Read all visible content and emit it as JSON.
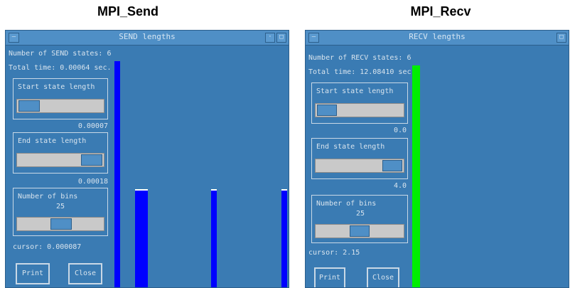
{
  "captions": {
    "left": "MPI_Send",
    "right": "MPI_Recv"
  },
  "windows": [
    {
      "title": "SEND lengths",
      "states_label": "Number of SEND states:  6",
      "total_time_label": "Total time:  0.00064 sec.",
      "start_group_label": "Start state length",
      "start_value": "0.00007",
      "end_group_label": "End state length",
      "end_value": "0.00018",
      "bins_group_label": "Number of bins",
      "bins_value": "25",
      "cursor_label": "cursor: 0.000087",
      "print_label": "Print",
      "close_label": "Close",
      "bar_color": "#0000ff",
      "start_slider_fraction": 0.0,
      "end_slider_fraction": 1.0,
      "bins_slider_fraction": 0.5
    },
    {
      "title": "RECV lengths",
      "states_label": "Number of RECV states:  6",
      "total_time_label": "Total time:  12.08410 sec.",
      "start_group_label": "Start state length",
      "start_value": "0.0",
      "end_group_label": "End state length",
      "end_value": "4.0",
      "bins_group_label": "Number of bins",
      "bins_value": "25",
      "cursor_label": "cursor: 2.15",
      "print_label": "Print",
      "close_label": "Close",
      "bar_color": "#00ee00",
      "start_slider_fraction": 0.0,
      "end_slider_fraction": 1.0,
      "bins_slider_fraction": 0.5
    }
  ]
}
